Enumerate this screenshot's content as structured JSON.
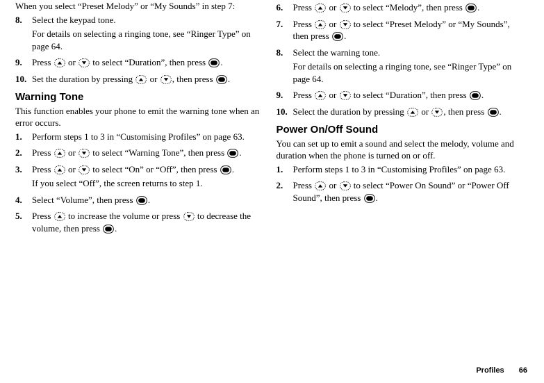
{
  "left": {
    "preface": "When you select “Preset Melody” or “My Sounds” in step 7:",
    "steps_a": [
      {
        "n": "8.",
        "body": "Select the keypad tone.",
        "sub": "For details on selecting a ringing tone, see “Ringer Type” on page 64."
      },
      {
        "n": "9.",
        "parts": [
          "Press ",
          "ICON_UP",
          " or ",
          "ICON_DOWN",
          " to select “Duration”, then press ",
          "ICON_CENTER",
          "."
        ]
      },
      {
        "n": "10.",
        "parts": [
          "Set the duration by pressing ",
          "ICON_UP",
          " or ",
          "ICON_DOWN",
          ", then press ",
          "ICON_CENTER",
          "."
        ]
      }
    ],
    "heading1": "Warning Tone",
    "intro1": "This function enables your phone to emit the warning tone when an error occurs.",
    "steps_b": [
      {
        "n": "1.",
        "body": "Perform steps 1 to 3 in “Customising Profiles” on page 63."
      },
      {
        "n": "2.",
        "parts": [
          "Press ",
          "ICON_UP",
          " or ",
          "ICON_DOWN",
          " to select “Warning Tone”, then press ",
          "ICON_CENTER",
          "."
        ]
      },
      {
        "n": "3.",
        "parts": [
          "Press ",
          "ICON_UP",
          " or ",
          "ICON_DOWN",
          " to select “On” or “Off”, then press ",
          "ICON_CENTER",
          "."
        ],
        "sub": "If you select “Off”, the screen returns to step 1."
      },
      {
        "n": "4.",
        "parts": [
          "Select “Volume”, then press ",
          "ICON_CENTER",
          "."
        ]
      },
      {
        "n": "5.",
        "parts": [
          "Press ",
          "ICON_UP",
          " to increase the volume or press ",
          "ICON_DOWN",
          " to decrease the volume, then press ",
          "ICON_CENTER",
          "."
        ]
      }
    ]
  },
  "right": {
    "steps_c": [
      {
        "n": "6.",
        "parts": [
          "Press ",
          "ICON_UP",
          " or ",
          "ICON_DOWN",
          " to select “Melody”, then press ",
          "ICON_CENTER",
          "."
        ]
      },
      {
        "n": "7.",
        "parts": [
          "Press ",
          "ICON_UP",
          " or ",
          "ICON_DOWN",
          " to select “Preset Melody” or “My Sounds”, then press ",
          "ICON_CENTER",
          "."
        ]
      },
      {
        "n": "8.",
        "body": "Select the warning tone.",
        "sub": "For details on selecting a ringing tone, see “Ringer Type” on page 64."
      },
      {
        "n": "9.",
        "parts": [
          "Press ",
          "ICON_UP",
          " or ",
          "ICON_DOWN",
          " to select “Duration”, then press ",
          "ICON_CENTER",
          "."
        ]
      },
      {
        "n": "10.",
        "parts": [
          "Select the duration by pressing ",
          "ICON_UP",
          " or ",
          "ICON_DOWN",
          ", then press ",
          "ICON_CENTER",
          "."
        ]
      }
    ],
    "heading2": "Power On/Off Sound",
    "intro2": "You can set up to emit a sound and select the melody, volume and duration when the phone is turned on or off.",
    "steps_d": [
      {
        "n": "1.",
        "body": "Perform steps 1 to 3 in “Customising Profiles” on page 63."
      },
      {
        "n": "2.",
        "parts": [
          "Press ",
          "ICON_UP",
          " or ",
          "ICON_DOWN",
          " to select “Power On Sound” or “Power Off Sound”, then press ",
          "ICON_CENTER",
          "."
        ]
      }
    ]
  },
  "footer": {
    "section": "Profiles",
    "page": "66"
  }
}
